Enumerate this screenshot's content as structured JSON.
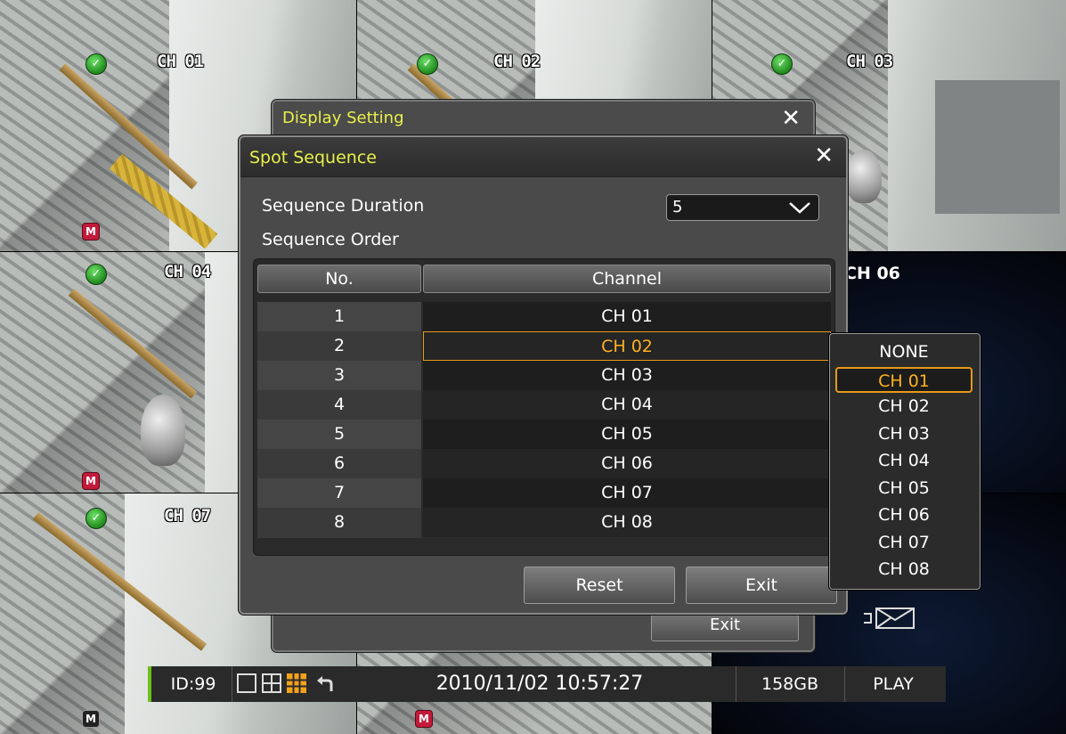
{
  "cameras": {
    "ch01": "CH 01",
    "ch02": "CH 02",
    "ch03": "CH 03",
    "ch04": "CH 04",
    "ch06": "CH 06",
    "ch07": "CH 07",
    "m_badge": "M"
  },
  "display_setting": {
    "title": "Display Setting",
    "exit_label": "Exit",
    "close_glyph": "✕"
  },
  "spot_sequence": {
    "title": "Spot Sequence",
    "close_glyph": "✕",
    "duration_label": "Sequence Duration",
    "duration_value": "5",
    "order_label": "Sequence Order",
    "columns": [
      "No.",
      "Channel"
    ],
    "rows": [
      {
        "no": "1",
        "channel": "CH 01"
      },
      {
        "no": "2",
        "channel": "CH 02"
      },
      {
        "no": "3",
        "channel": "CH 03"
      },
      {
        "no": "4",
        "channel": "CH 04"
      },
      {
        "no": "5",
        "channel": "CH 05"
      },
      {
        "no": "6",
        "channel": "CH 06"
      },
      {
        "no": "7",
        "channel": "CH 07"
      },
      {
        "no": "8",
        "channel": "CH 08"
      }
    ],
    "selected_row": 2,
    "reset_label": "Reset",
    "exit_label": "Exit"
  },
  "channel_dropdown": {
    "options": [
      "NONE",
      "CH 01",
      "CH 02",
      "CH 03",
      "CH 04",
      "CH 05",
      "CH 06",
      "CH 07",
      "CH 08"
    ],
    "highlighted": "CH 01"
  },
  "statusbar": {
    "id": "ID:99",
    "datetime": "2010/11/02 10:57:27",
    "storage": "158GB",
    "mode": "PLAY"
  },
  "colors": {
    "accent_title": "#e9f04a",
    "selection": "#e59a18",
    "status_ok": "#1f8a1c",
    "record_badge": "#c21b3a"
  },
  "icons": [
    "ok-check-icon",
    "m-badge-icon",
    "close-icon",
    "chevron-down-icon",
    "single-view-icon",
    "quad-view-icon",
    "grid-9-view-icon",
    "return-icon",
    "mail-icon"
  ]
}
